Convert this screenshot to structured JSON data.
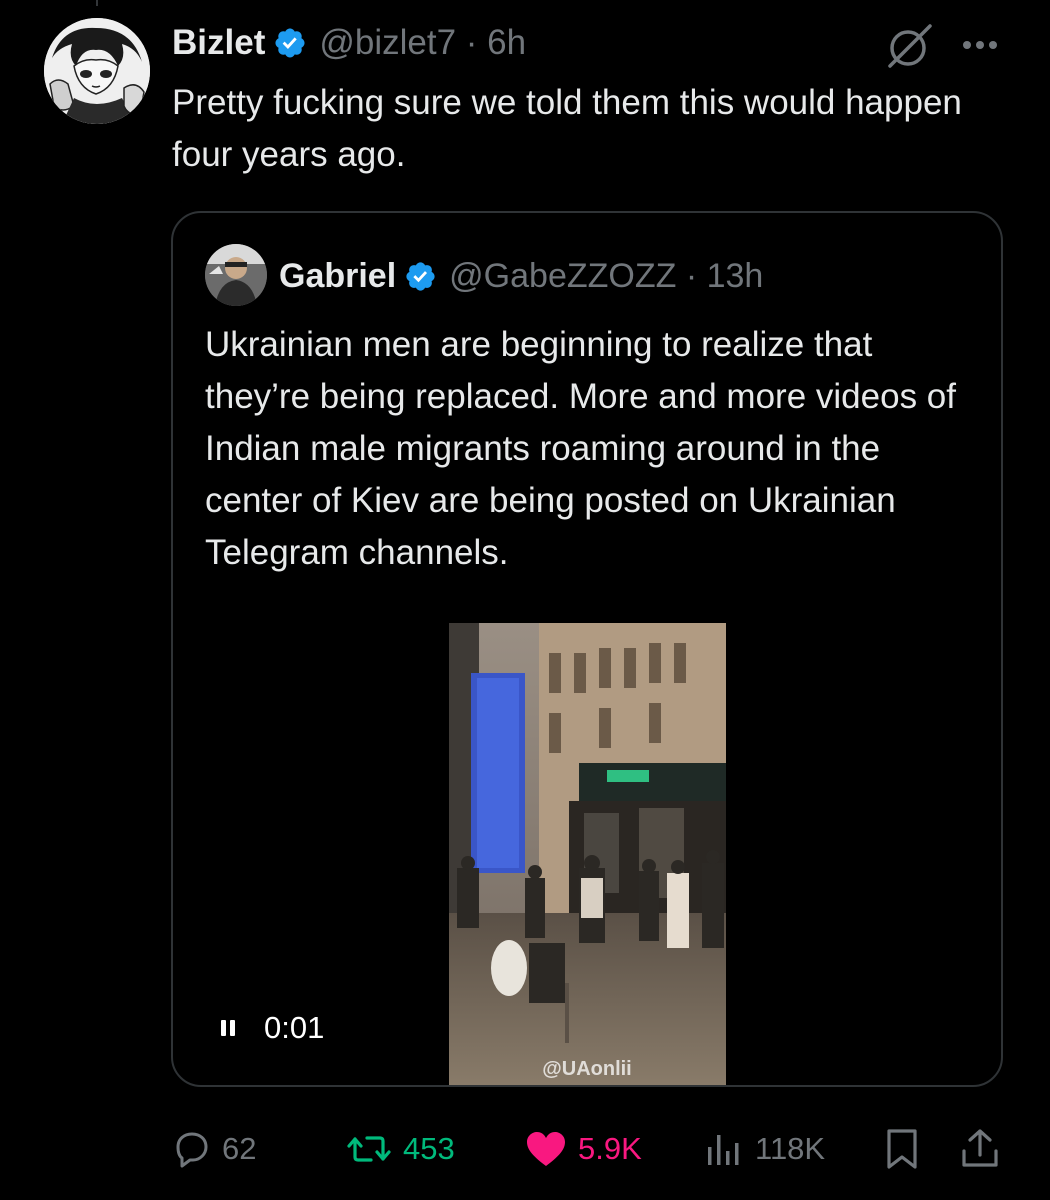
{
  "tweet": {
    "author": {
      "display_name": "Bizlet",
      "handle_time": "@bizlet7 · 6h",
      "avatar": "anime-character-avatar"
    },
    "text": "Pretty fucking sure we told them this would happen four years ago.",
    "quote": {
      "author": {
        "display_name": "Gabriel",
        "handle_time": "@GabeZZOZZ · 13h",
        "avatar": "person-avatar"
      },
      "text": "Ukrainian men are beginning to realize that they’re being replaced. More and more videos of Indian male migrants roaming around in the center of Kiev are being posted on Ukrainian Telegram channels.",
      "video": {
        "watermark": "@UAonlii",
        "time": "0:01",
        "state": "playing"
      }
    },
    "stats": {
      "replies": "62",
      "retweets": "453",
      "likes": "5.9K",
      "views": "118K"
    }
  },
  "icons": {
    "verified": "verified-badge-icon",
    "grok": "grok-icon",
    "more": "more-icon",
    "pause": "pause-icon",
    "reply": "reply-icon",
    "retweet": "retweet-icon",
    "like": "heart-icon",
    "views": "views-icon",
    "bookmark": "bookmark-icon",
    "share": "share-icon"
  },
  "colors": {
    "background": "#000000",
    "text_primary": "#e7e9ea",
    "text_secondary": "#71767b",
    "verified": "#1d9bf0",
    "retweet_active": "#00ba7c",
    "like_active": "#f91880",
    "border": "#2f3336"
  }
}
